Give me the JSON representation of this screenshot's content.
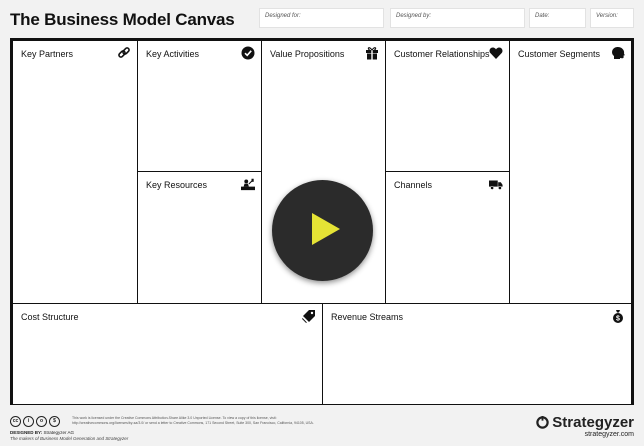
{
  "title": "The Business Model Canvas",
  "meta": {
    "designed_for": "Designed for:",
    "designed_by": "Designed by:",
    "date": "Date:",
    "version": "Version:"
  },
  "blocks": {
    "key_partners": "Key Partners",
    "key_activities": "Key Activities",
    "key_resources": "Key Resources",
    "value_propositions": "Value Propositions",
    "customer_relationships": "Customer Relationships",
    "channels": "Channels",
    "customer_segments": "Customer Segments",
    "cost_structure": "Cost Structure",
    "revenue_streams": "Revenue Streams"
  },
  "icons": {
    "key_partners": "link-icon",
    "key_activities": "check-circle-icon",
    "key_resources": "worker-icon",
    "value_propositions": "gift-icon",
    "customer_relationships": "heart-icon",
    "channels": "truck-icon",
    "customer_segments": "head-icon",
    "cost_structure": "price-tag-icon",
    "revenue_streams": "money-bag-icon",
    "play": "play-icon"
  },
  "colors": {
    "play_button_bg": "#2b2b2b",
    "play_triangle": "#e5e335",
    "border": "#111111",
    "background": "#f2f2f2"
  },
  "footer": {
    "license": "This work is licensed under the Creative Commons Attribution-Share Alike 3.0 Unported License. To view a copy of this license, visit: http://creativecommons.org/licenses/by-sa/3.0/ or send a letter to Creative Commons, 171 Second Street, Suite 300, San Francisco, California, 94105, USA.",
    "designed_by_label": "DESIGNED BY:",
    "designed_by_name": "Strategyzer AG",
    "subtitle": "The makers of Business Model Generation and Strategyzer",
    "brand": "Strategyzer",
    "url": "strategyzer.com"
  }
}
